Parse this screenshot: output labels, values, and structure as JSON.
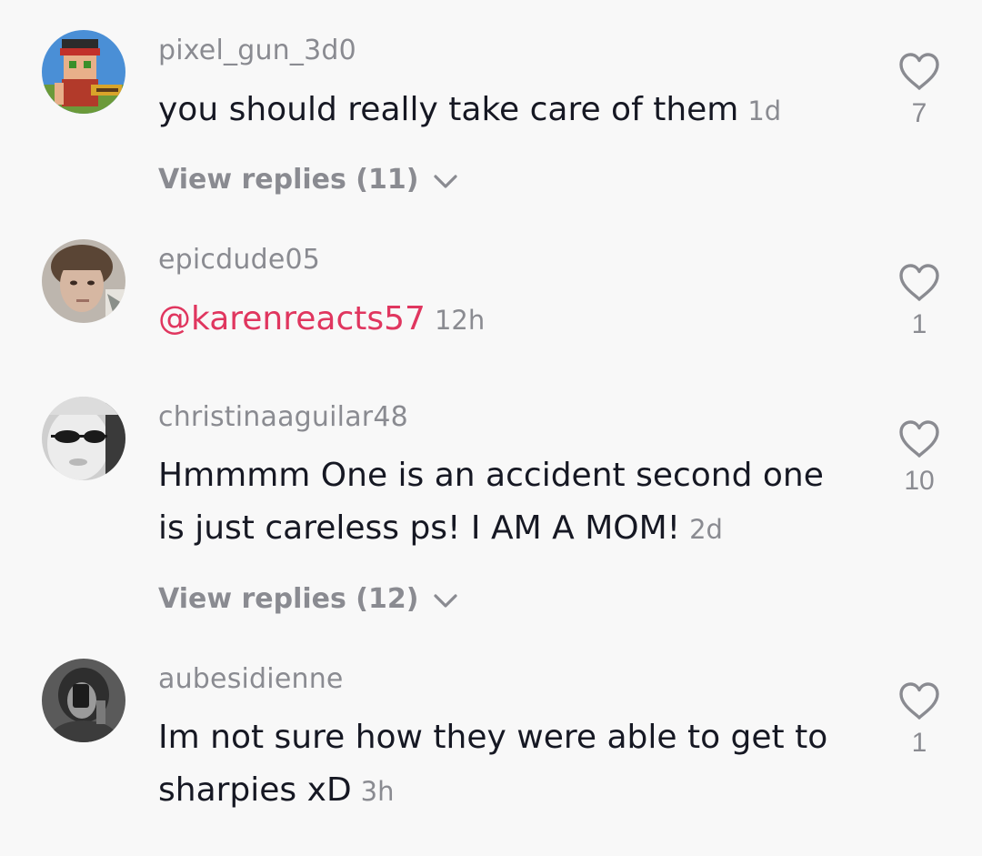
{
  "comments": [
    {
      "username": "pixel_gun_3d0",
      "text": "you should really take care of them",
      "time": "1d",
      "likes": "7",
      "replies_label": "View replies (11)",
      "avatar_icon": "pixel-game-character-avatar"
    },
    {
      "username": "epicdude05",
      "mention": "@karenreacts57",
      "time": "12h",
      "likes": "1",
      "avatar_icon": "person-photo-avatar"
    },
    {
      "username": "christinaaguilar48",
      "text": "Hmmmm One is an accident second one is just careless ps! I AM A MOM!",
      "time": "2d",
      "likes": "10",
      "replies_label": "View replies (12)",
      "avatar_icon": "sunglasses-photo-avatar"
    },
    {
      "username": "aubesidienne",
      "text": "Im not sure how they were able to get to sharpies xD",
      "time": "3h",
      "likes": "1",
      "avatar_icon": "mirror-selfie-avatar"
    }
  ],
  "colors": {
    "background": "#f8f8f8",
    "text": "#161823",
    "secondary": "#8a8b91",
    "mention": "#e0365f"
  },
  "icons": {
    "like": "heart-outline-icon",
    "expand": "chevron-down-icon"
  }
}
